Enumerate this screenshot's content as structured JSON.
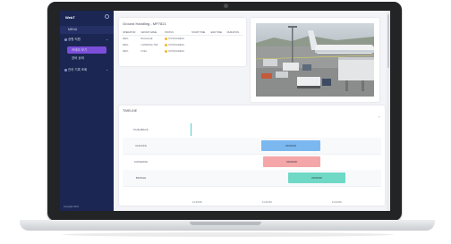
{
  "sidebar": {
    "brand": "WebT",
    "header": "MENU",
    "section": "공항 지원",
    "items": [
      {
        "label": "카메라 보기"
      },
      {
        "label": "장비 상태"
      }
    ],
    "section2": "관리 기록 조회",
    "footer": "Copyright 2023"
  },
  "ground_handling": {
    "title": "Ground Handling - MP7821",
    "columns": [
      "OPERATOR",
      "GROUP NAME",
      "STATUS",
      "START TIME",
      "END TIME",
      "DURATION"
    ],
    "rows": [
      {
        "operator": "REFL",
        "group": "BAGGAGE",
        "status": "IN PROGRESS",
        "start": "",
        "end": "",
        "duration": ""
      },
      {
        "operator": "REFL",
        "group": "CATERING TRK",
        "status": "IN PROGRESS",
        "start": "",
        "end": "",
        "duration": ""
      },
      {
        "operator": "REFL",
        "group": "FUEL",
        "status": "IN PROGRESS",
        "start": "",
        "end": "",
        "duration": ""
      }
    ]
  },
  "timeline": {
    "title": "TIMELINE",
    "rows": [
      {
        "label": "PUSHBACK",
        "bar_text": ""
      },
      {
        "label": "CHOCKS",
        "bar_text": "00:00:00",
        "color": "#7ab8ef"
      },
      {
        "label": "CATERING",
        "bar_text": "00:00:00",
        "color": "#f4a6a8"
      },
      {
        "label": "BRIDGE",
        "bar_text": "00:00:00",
        "color": "#6fd9c6"
      }
    ],
    "ticks": [
      "11:40:00",
      "11:42:00",
      "11:44:00"
    ]
  }
}
